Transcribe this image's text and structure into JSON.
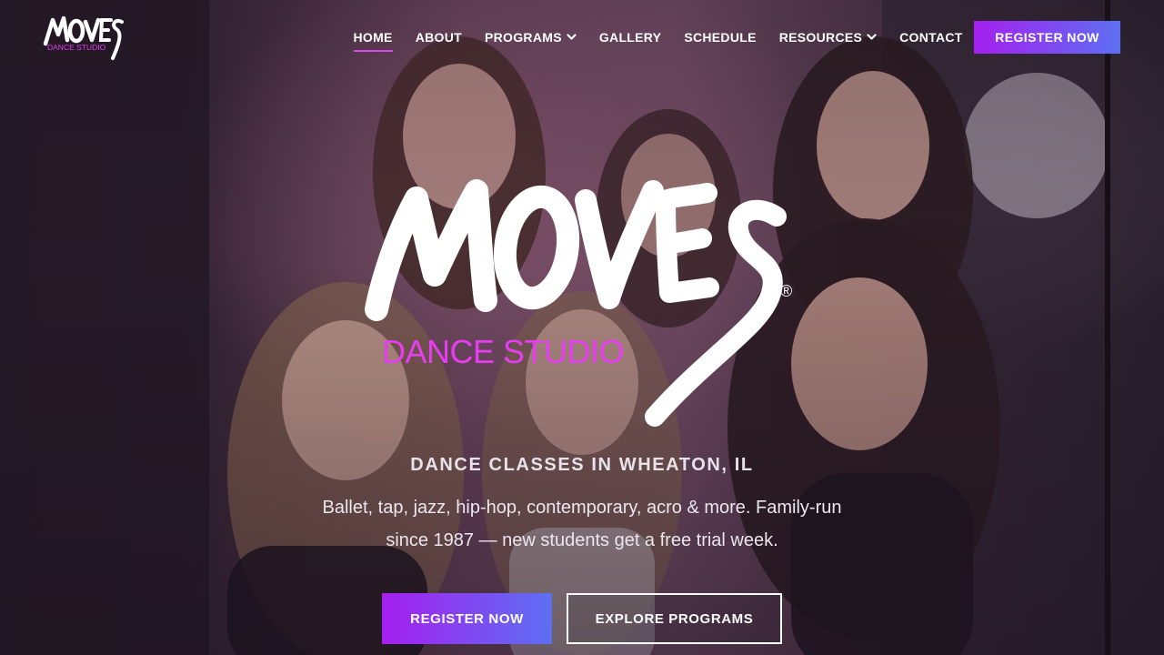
{
  "brand": {
    "name": "MOVES",
    "logo_subtitle": "DANCE STUDIO",
    "registered_mark": "®",
    "accent_color": "#e53df0",
    "button_gradient": [
      "#a51ff0",
      "#5d6ff2"
    ]
  },
  "nav": {
    "items": [
      {
        "label": "HOME",
        "active": true,
        "has_dropdown": false
      },
      {
        "label": "ABOUT",
        "active": false,
        "has_dropdown": false
      },
      {
        "label": "PROGRAMS",
        "active": false,
        "has_dropdown": true
      },
      {
        "label": "GALLERY",
        "active": false,
        "has_dropdown": false
      },
      {
        "label": "SCHEDULE",
        "active": false,
        "has_dropdown": false
      },
      {
        "label": "RESOURCES",
        "active": false,
        "has_dropdown": true
      },
      {
        "label": "CONTACT",
        "active": false,
        "has_dropdown": false
      }
    ],
    "register_label": "REGISTER NOW"
  },
  "hero": {
    "tagline": "DANCE CLASSES IN WHEATON, IL",
    "description": "Ballet, tap, jazz, hip-hop, contemporary, acro & more. Family-run since 1987 — new students get a free trial week.",
    "primary_cta": "REGISTER NOW",
    "secondary_cta": "EXPLORE PROGRAMS",
    "background_image": "group-of-smiling-girls-photo"
  }
}
